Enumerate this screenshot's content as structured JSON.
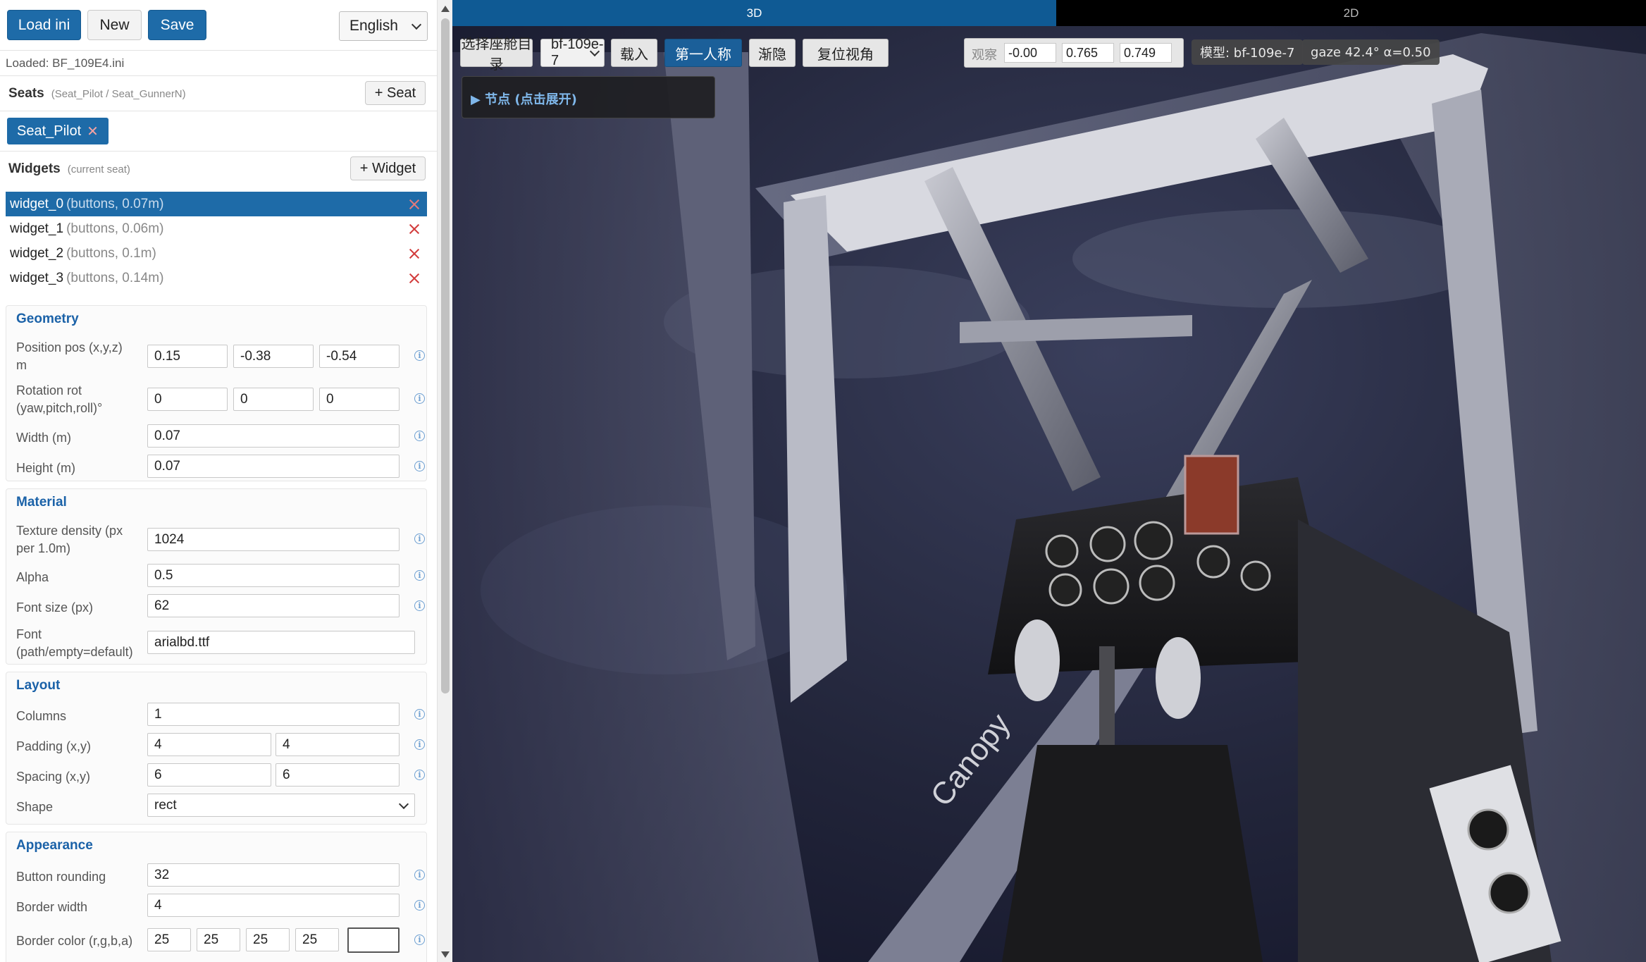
{
  "toolbar": {
    "load_label": "Load ini",
    "new_label": "New",
    "save_label": "Save",
    "language_value": "English"
  },
  "loaded_text": "Loaded: BF_109E4.ini",
  "seats": {
    "title": "Seats",
    "subtitle": "(Seat_Pilot / Seat_GunnerN)",
    "add_label": "+ Seat",
    "chip_label": "Seat_Pilot",
    "chip_remove": "✕"
  },
  "widgets": {
    "title": "Widgets",
    "subtitle": "(current seat)",
    "add_label": "+ Widget",
    "items": [
      {
        "name": "widget_0",
        "meta": "(buttons, 0.07m)"
      },
      {
        "name": "widget_1",
        "meta": "(buttons, 0.06m)"
      },
      {
        "name": "widget_2",
        "meta": "(buttons, 0.1m)"
      },
      {
        "name": "widget_3",
        "meta": "(buttons, 0.14m)"
      }
    ]
  },
  "geometry": {
    "title": "Geometry",
    "position_label_1": "Position pos (x,y,z)",
    "position_label_2": "m",
    "pos_x": "0.15",
    "pos_y": "-0.38",
    "pos_z": "-0.54",
    "rotation_label_1": "Rotation rot",
    "rotation_label_2": "(yaw,pitch,roll)°",
    "rot_yaw": "0",
    "rot_pitch": "0",
    "rot_roll": "0",
    "width_label": "Width (m)",
    "width_value": "0.07",
    "height_label": "Height (m)",
    "height_value": "0.07"
  },
  "material": {
    "title": "Material",
    "density_label_1": "Texture density (px",
    "density_label_2": "per 1.0m)",
    "density_value": "1024",
    "alpha_label": "Alpha",
    "alpha_value": "0.5",
    "fontsize_label": "Font size (px)",
    "fontsize_value": "62",
    "font_label_1": "Font",
    "font_label_2": "(path/empty=default)",
    "font_value": "arialbd.ttf"
  },
  "layout": {
    "title": "Layout",
    "columns_label": "Columns",
    "columns_value": "1",
    "padding_label": "Padding (x,y)",
    "padding_x": "4",
    "padding_y": "4",
    "spacing_label": "Spacing (x,y)",
    "spacing_x": "6",
    "spacing_y": "6",
    "shape_label": "Shape",
    "shape_value": "rect"
  },
  "appearance": {
    "title": "Appearance",
    "rounding_label": "Button rounding",
    "rounding_value": "32",
    "border_width_label": "Border width",
    "border_width_value": "4",
    "border_color_label": "Border color (r,g,b,a)",
    "border_r": "25",
    "border_g": "25",
    "border_b": "25",
    "border_a": "25",
    "border_color_swatch": "#ffffff"
  },
  "view": {
    "tab_3d": "3D",
    "tab_2d": "2D",
    "select_dir_label": "选择座舱目录",
    "model_select_value": "bf-109e-7",
    "load_label": "载入",
    "first_person_label": "第一人称",
    "fade_label": "渐隐",
    "reset_view_label": "复位视角",
    "observe_label": "观察",
    "obs_x": "-0.00",
    "obs_y": "0.765",
    "obs_z": "0.749",
    "model_badge": "模型: bf-109e-7",
    "gaze_badge": "gaze 42.4° α=0.50",
    "nodes_label": "▶ 节点 (点击展开)",
    "canopy_text": "Canopy"
  },
  "info_glyph": "i",
  "colors": {
    "primary": "#1e6ba8",
    "section_title": "#1b62a8",
    "delete": "#d23c3c",
    "tab_active": "#0f5a94"
  }
}
